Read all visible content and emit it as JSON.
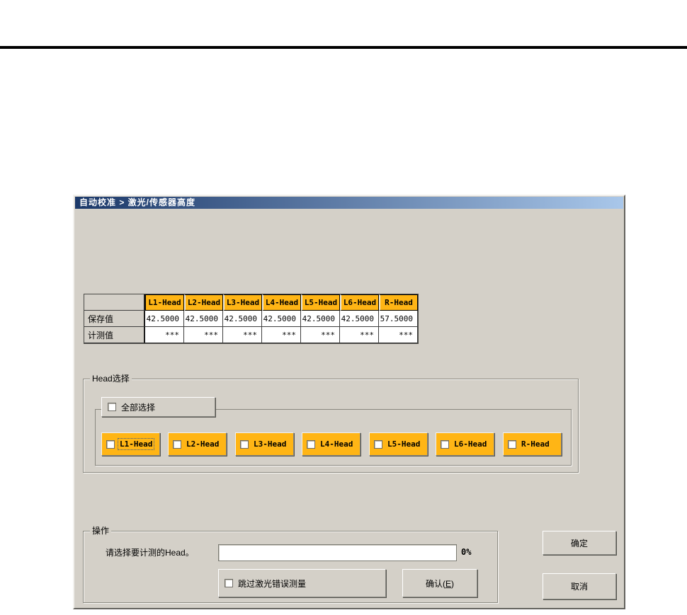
{
  "window": {
    "title": "自动校准 > 激光/传感器高度"
  },
  "colors": {
    "dialog_bg": "#d4d0c8",
    "title_gradient_left": "#1b3869",
    "title_gradient_right": "#a9c7ea",
    "head_orange": "#ffb515",
    "top_divider": "#000000"
  },
  "table": {
    "columns": [
      "L1-Head",
      "L2-Head",
      "L3-Head",
      "L4-Head",
      "L5-Head",
      "L6-Head",
      "R-Head"
    ],
    "rows": [
      {
        "label": "保存值",
        "values": [
          "42.5000",
          "42.5000",
          "42.5000",
          "42.5000",
          "42.5000",
          "42.5000",
          "57.5000"
        ]
      },
      {
        "label": "计测值",
        "values": [
          "***",
          "***",
          "***",
          "***",
          "***",
          "***",
          "***"
        ]
      }
    ]
  },
  "head_select": {
    "group_label": "Head选择",
    "select_all": "全部选择",
    "heads": [
      "L1-Head",
      "L2-Head",
      "L3-Head",
      "L4-Head",
      "L5-Head",
      "L6-Head",
      "R-Head"
    ]
  },
  "operation": {
    "group_label": "操作",
    "prompt": "请选择要计测的Head。",
    "progress_percent": "0%",
    "skip_checkbox": "跳过激光错误测量",
    "confirm_prefix": "确认(",
    "confirm_key": "E",
    "confirm_suffix": ")"
  },
  "actions": {
    "ok": "确定",
    "cancel": "取消"
  }
}
